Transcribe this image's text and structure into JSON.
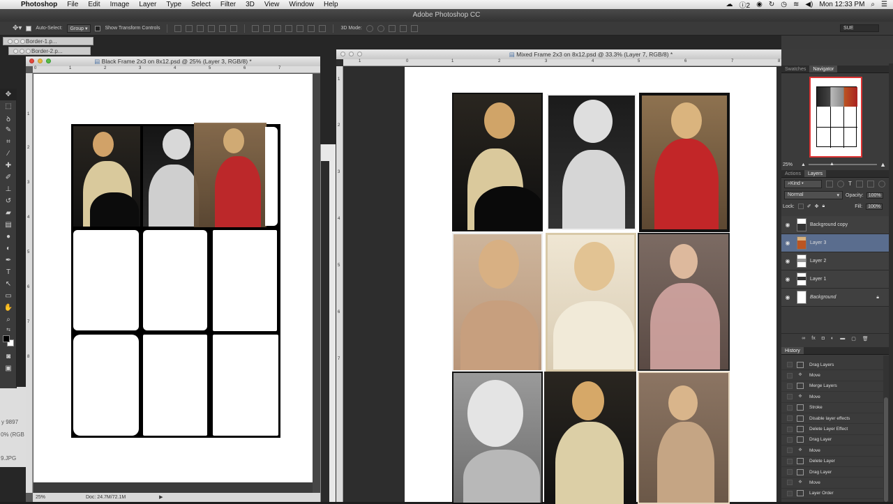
{
  "menubar": {
    "items": [
      "Photoshop",
      "File",
      "Edit",
      "Image",
      "Layer",
      "Type",
      "Select",
      "Filter",
      "3D",
      "View",
      "Window",
      "Help"
    ],
    "input_badge": "2",
    "clock": "Mon 12:33 PM"
  },
  "window_title": "Adobe Photoshop CC",
  "options_bar": {
    "auto_select_label": "Auto-Select:",
    "auto_select_value": "Group",
    "transform_label": "Show Transform Controls",
    "mode_3d_label": "3D Mode:",
    "workspace_value": "SUE"
  },
  "docs": {
    "border1": "Border-1.p...",
    "border2": "Border-2.p...",
    "black_frame": "Black Frame 2x3 on 8x12.psd @ 25% (Layer 3, RGB/8) *",
    "mixed_frame": "Mixed Frame 2x3 on 8x12.psd @ 33.3% (Layer 7, RGB/8) *",
    "status_zoom": "25%",
    "status_doc": "Doc: 24.7M/72.1M",
    "side_text1": "y 9897",
    "side_text2": "0% (RGB",
    "side_text3": "9.JPG"
  },
  "ruler_left": [
    "0",
    "1",
    "2",
    "3",
    "4",
    "5",
    "6",
    "7"
  ],
  "ruler_right": [
    "1",
    "0",
    "1",
    "2",
    "3",
    "4",
    "5",
    "6",
    "7",
    "8"
  ],
  "ruler_right_v": [
    "1",
    "2",
    "3",
    "4",
    "5",
    "6",
    "7"
  ],
  "ruler_left_v": [
    "1",
    "2",
    "3",
    "4",
    "5",
    "6",
    "7",
    "8"
  ],
  "navigator": {
    "tabs": [
      "Swatches",
      "Navigator"
    ],
    "active": "Navigator",
    "zoom": "25%"
  },
  "layers_panel": {
    "tabs": [
      "Actions",
      "Layers"
    ],
    "active": "Layers",
    "kind_label": "Kind",
    "blend_mode": "Normal",
    "opacity_label": "Opacity:",
    "opacity_value": "100%",
    "lock_label": "Lock:",
    "fill_label": "Fill:",
    "fill_value": "100%",
    "layers": [
      {
        "name": "Background copy",
        "selected": false
      },
      {
        "name": "Layer 3",
        "selected": true
      },
      {
        "name": "Layer 2",
        "selected": false
      },
      {
        "name": "Layer 1",
        "selected": false
      },
      {
        "name": "Background",
        "selected": false
      }
    ]
  },
  "history": {
    "title": "History",
    "items": [
      "Drag Layers",
      "Move",
      "Merge Layers",
      "Move",
      "Stroke",
      "Disable layer effects",
      "Delete Layer Effect",
      "Drag Layer",
      "Move",
      "Delete Layer",
      "Drag Layer",
      "Move",
      "Layer Order"
    ]
  },
  "colors": {
    "photo_red": "#b8262a",
    "photo_sepia": "#c8a98a",
    "photo_dark": "#1a1a1a",
    "layer_selected": "#5a6d8e"
  }
}
